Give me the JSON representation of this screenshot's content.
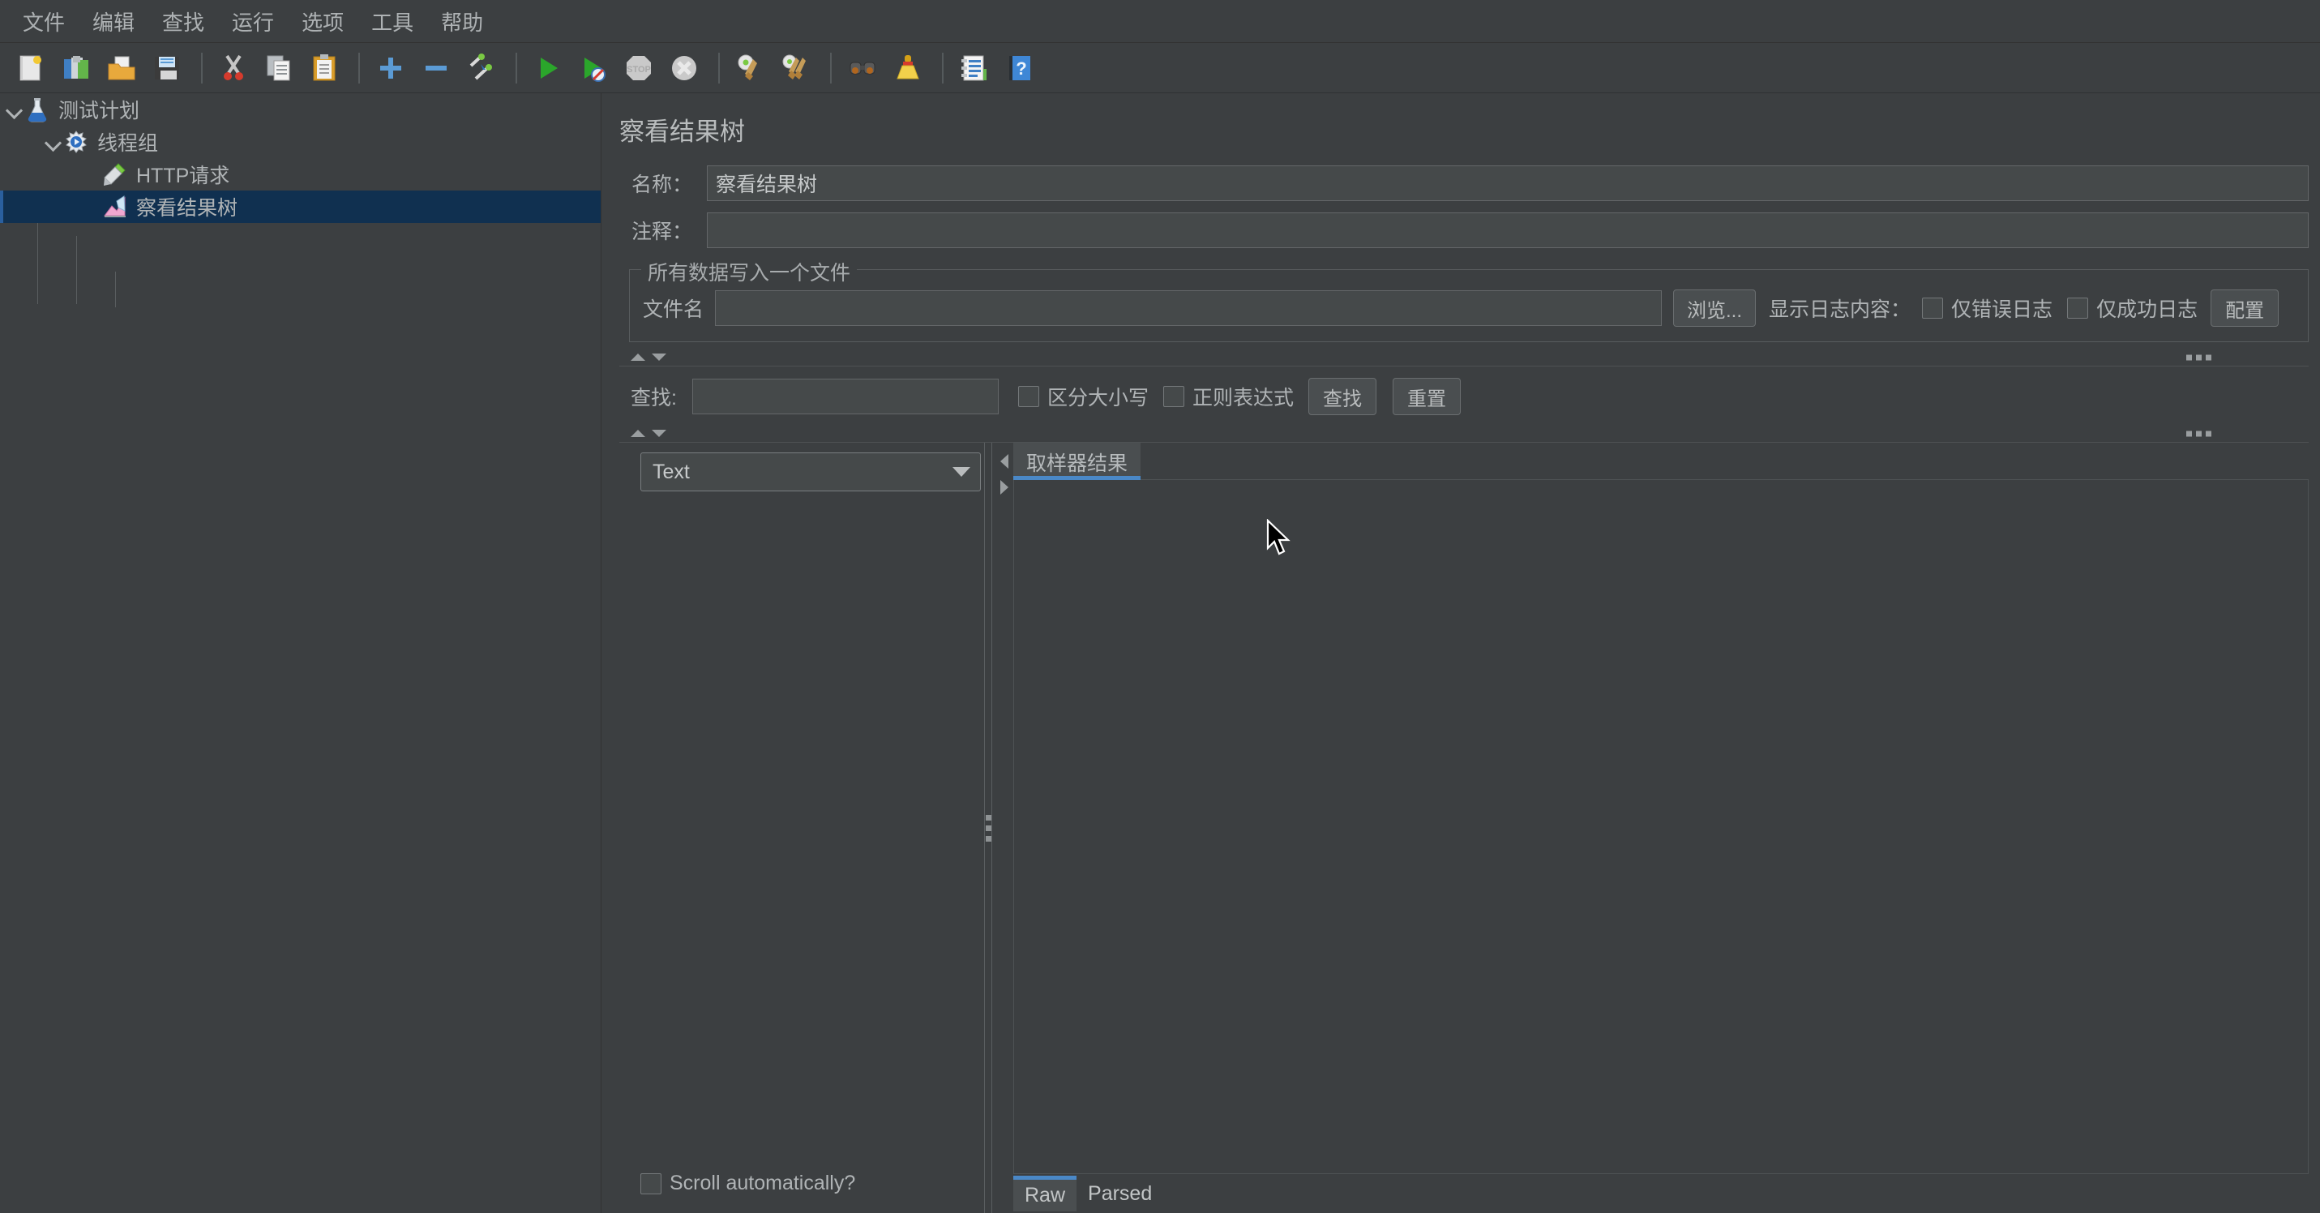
{
  "menu": {
    "items": [
      {
        "label": "文件",
        "name": "menu-file"
      },
      {
        "label": "编辑",
        "name": "menu-edit"
      },
      {
        "label": "查找",
        "name": "menu-search"
      },
      {
        "label": "运行",
        "name": "menu-run"
      },
      {
        "label": "选项",
        "name": "menu-options"
      },
      {
        "label": "工具",
        "name": "menu-tools"
      },
      {
        "label": "帮助",
        "name": "menu-help"
      }
    ]
  },
  "toolbar": {
    "icons": [
      "new-document-icon",
      "open-template-icon",
      "open-folder-icon",
      "save-icon",
      "cut-icon",
      "copy-icon",
      "paste-icon",
      "expand-all-icon",
      "collapse-all-icon",
      "toggle-icon",
      "start-icon",
      "start-no-timers-icon",
      "stop-icon",
      "shutdown-icon",
      "clear-icon",
      "clear-all-icon",
      "search-icon",
      "search-reset-icon",
      "function-helper-icon",
      "help-icon"
    ]
  },
  "tree": {
    "nodes": [
      {
        "label": "测试计划",
        "icon": "test-plan-icon",
        "depth": 0,
        "expanded": true,
        "selected": false
      },
      {
        "label": "线程组",
        "icon": "thread-group-icon",
        "depth": 1,
        "expanded": true,
        "selected": false
      },
      {
        "label": "HTTP请求",
        "icon": "http-request-icon",
        "depth": 2,
        "expanded": false,
        "selected": false
      },
      {
        "label": "察看结果树",
        "icon": "view-results-tree-icon",
        "depth": 2,
        "expanded": false,
        "selected": true
      }
    ]
  },
  "panel": {
    "title": "察看结果树",
    "name_label": "名称：",
    "name_value": "察看结果树",
    "comment_label": "注释：",
    "comment_value": "",
    "filegroup": {
      "title": "所有数据写入一个文件",
      "filename_label": "文件名",
      "filename_value": "",
      "browse_button": "浏览...",
      "log_display_label": "显示日志内容：",
      "errors_only_label": "仅错误日志",
      "errors_only_checked": false,
      "success_only_label": "仅成功日志",
      "success_only_checked": false,
      "configure_button": "配置"
    },
    "search": {
      "label": "查找:",
      "value": "",
      "case_sensitive_label": "区分大小写",
      "case_sensitive_checked": false,
      "regex_label": "正则表达式",
      "regex_checked": false,
      "find_button": "查找",
      "reset_button": "重置"
    },
    "renderer": {
      "selected": "Text"
    },
    "scroll_auto_label": "Scroll automatically?",
    "scroll_auto_checked": false,
    "result_tabs": [
      {
        "label": "取样器结果",
        "active": true
      }
    ],
    "raw_parsed_tabs": [
      {
        "label": "Raw",
        "active": true
      },
      {
        "label": "Parsed",
        "active": false
      }
    ]
  },
  "colors": {
    "background": "#3c3f41",
    "field": "#45494a",
    "accent": "#4a88c7",
    "selection": "#103050",
    "text": "#b9bcbd"
  }
}
